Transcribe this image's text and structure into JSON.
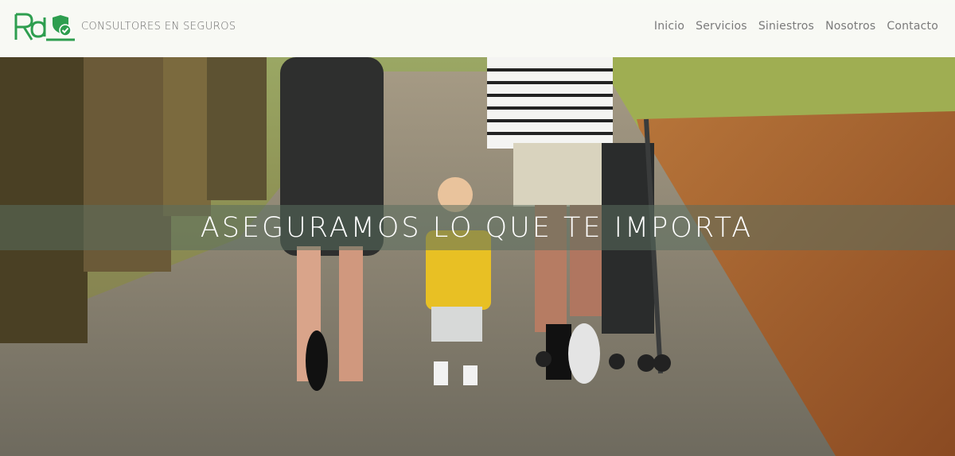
{
  "header": {
    "brand_text": "CONSULTORES EN SEGUROS",
    "logo_letters": "RdL",
    "logo_icon": "shield-check-icon",
    "nav": [
      {
        "label": "Inicio"
      },
      {
        "label": "Servicios"
      },
      {
        "label": "Siniestros"
      },
      {
        "label": "Nosotros"
      },
      {
        "label": "Contacto"
      }
    ]
  },
  "hero": {
    "tagline": "ASEGURAMOS LO QUE TE IMPORTA",
    "image_subject": "family-walking-park-photo"
  },
  "colors": {
    "brand_green": "#2e9e4f",
    "nav_text": "#7a7a7a",
    "band_overlay": "#5a6e5f"
  }
}
